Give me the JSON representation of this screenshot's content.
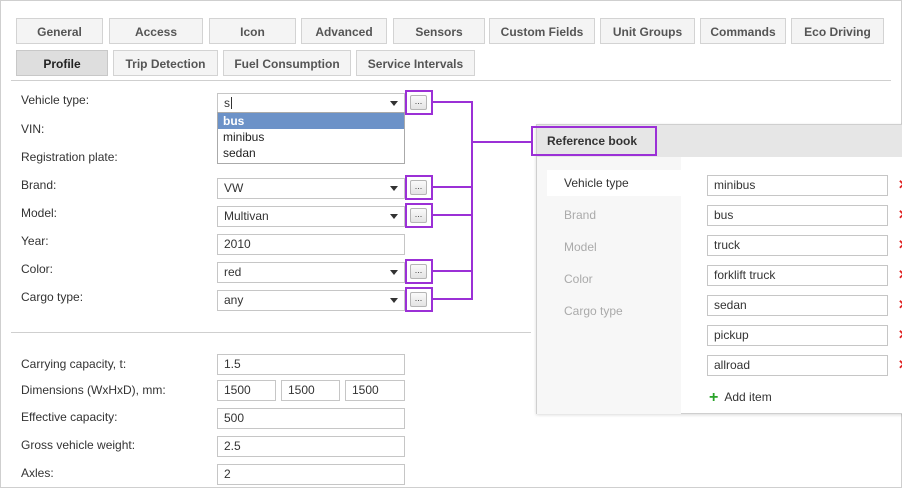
{
  "tabs_row1": [
    "General",
    "Access",
    "Icon",
    "Advanced",
    "Sensors",
    "Custom Fields",
    "Unit Groups",
    "Commands",
    "Eco Driving"
  ],
  "tabs_row2": [
    "Profile",
    "Trip Detection",
    "Fuel Consumption",
    "Service Intervals"
  ],
  "active_tab": "Profile",
  "profile": {
    "vehicle_type": {
      "label": "Vehicle type:",
      "value": "s"
    },
    "vin": {
      "label": "VIN:"
    },
    "registration_plate": {
      "label": "Registration plate:"
    },
    "brand": {
      "label": "Brand:",
      "value": "VW"
    },
    "model": {
      "label": "Model:",
      "value": "Multivan"
    },
    "year": {
      "label": "Year:",
      "value": "2010"
    },
    "color": {
      "label": "Color:",
      "value": "red"
    },
    "cargo_type": {
      "label": "Cargo type:",
      "value": "any"
    },
    "dropdown_options": [
      "bus",
      "minibus",
      "sedan"
    ],
    "dropdown_selected": "bus",
    "carrying_capacity": {
      "label": "Carrying capacity, t:",
      "value": "1.5"
    },
    "dimensions": {
      "label": "Dimensions (WxHxD), mm:",
      "w": "1500",
      "h": "1500",
      "d": "1500"
    },
    "effective_capacity": {
      "label": "Effective capacity:",
      "value": "500"
    },
    "gross_weight": {
      "label": "Gross vehicle weight:",
      "value": "2.5"
    },
    "axles": {
      "label": "Axles:",
      "value": "2"
    }
  },
  "reference_book": {
    "title": "Reference book",
    "categories": [
      "Vehicle type",
      "Brand",
      "Model",
      "Color",
      "Cargo type"
    ],
    "active_category": "Vehicle type",
    "items": [
      "minibus",
      "bus",
      "truck",
      "forklift truck",
      "sedan",
      "pickup",
      "allroad"
    ],
    "add_label": "Add item",
    "delete_glyph": "✕"
  },
  "browse_button_label": "...",
  "colors": {
    "highlight": "#9b30d6",
    "selected": "#6c92c8",
    "delete": "#e02020",
    "add": "#29a329"
  }
}
